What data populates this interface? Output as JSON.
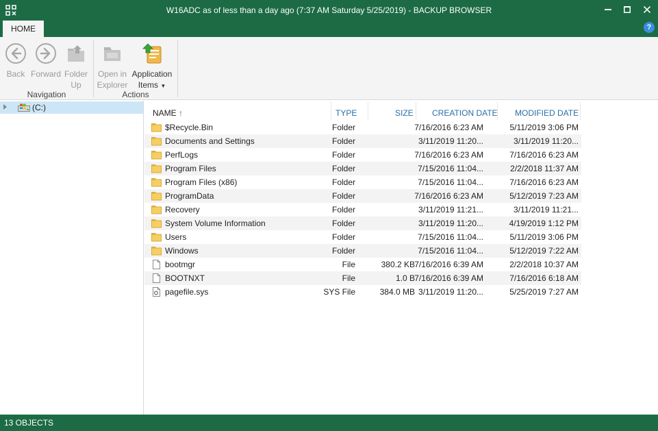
{
  "window": {
    "title": "W16ADC as of less than a day ago (7:37 AM Saturday 5/25/2019) - BACKUP BROWSER",
    "accent_color": "#1c6b45"
  },
  "tabs": {
    "home": "HOME",
    "help": "?"
  },
  "ribbon": {
    "navigation": {
      "label": "Navigation",
      "back": {
        "line1": "Back",
        "icon": "back-arrow-icon"
      },
      "forward": {
        "line1": "Forward",
        "icon": "forward-arrow-icon"
      },
      "folder_up": {
        "line1": "Folder",
        "line2": "Up",
        "icon": "folder-up-icon"
      }
    },
    "actions": {
      "label": "Actions",
      "open_in_explorer": {
        "line1": "Open in",
        "line2": "Explorer",
        "icon": "explorer-folder-icon"
      },
      "application_items": {
        "line1": "Application",
        "line2": "Items",
        "icon": "application-items-icon"
      }
    }
  },
  "tree": {
    "items": [
      {
        "label": "(C:)",
        "icon": "drive-icon",
        "selected": true
      }
    ]
  },
  "list": {
    "columns": {
      "name": "NAME",
      "type": "TYPE",
      "size": "SIZE",
      "created": "CREATION DATE",
      "modified": "MODIFIED DATE"
    },
    "sort_column": "name",
    "rows": [
      {
        "name": "$Recycle.Bin",
        "type": "Folder",
        "size": "",
        "created": "7/16/2016 6:23 AM",
        "modified": "5/11/2019 3:06 PM",
        "icon": "folder"
      },
      {
        "name": "Documents and Settings",
        "type": "Folder",
        "size": "",
        "created": "3/11/2019 11:20...",
        "modified": "3/11/2019 11:20...",
        "icon": "folder"
      },
      {
        "name": "PerfLogs",
        "type": "Folder",
        "size": "",
        "created": "7/16/2016 6:23 AM",
        "modified": "7/16/2016 6:23 AM",
        "icon": "folder"
      },
      {
        "name": "Program Files",
        "type": "Folder",
        "size": "",
        "created": "7/15/2016 11:04...",
        "modified": "2/2/2018 11:37 AM",
        "icon": "folder"
      },
      {
        "name": "Program Files (x86)",
        "type": "Folder",
        "size": "",
        "created": "7/15/2016 11:04...",
        "modified": "7/16/2016 6:23 AM",
        "icon": "folder"
      },
      {
        "name": "ProgramData",
        "type": "Folder",
        "size": "",
        "created": "7/16/2016 6:23 AM",
        "modified": "5/12/2019 7:23 AM",
        "icon": "folder"
      },
      {
        "name": "Recovery",
        "type": "Folder",
        "size": "",
        "created": "3/11/2019 11:21...",
        "modified": "3/11/2019 11:21...",
        "icon": "folder"
      },
      {
        "name": "System Volume Information",
        "type": "Folder",
        "size": "",
        "created": "3/11/2019 11:20...",
        "modified": "4/19/2019 1:12 PM",
        "icon": "folder"
      },
      {
        "name": "Users",
        "type": "Folder",
        "size": "",
        "created": "7/15/2016 11:04...",
        "modified": "5/11/2019 3:06 PM",
        "icon": "folder"
      },
      {
        "name": "Windows",
        "type": "Folder",
        "size": "",
        "created": "7/15/2016 11:04...",
        "modified": "5/12/2019 7:22 AM",
        "icon": "folder"
      },
      {
        "name": "bootmgr",
        "type": "File",
        "size": "380.2 KB",
        "created": "7/16/2016 6:39 AM",
        "modified": "2/2/2018 10:37 AM",
        "icon": "file"
      },
      {
        "name": "BOOTNXT",
        "type": "File",
        "size": "1.0 B",
        "created": "7/16/2016 6:39 AM",
        "modified": "7/16/2016 6:18 AM",
        "icon": "file"
      },
      {
        "name": "pagefile.sys",
        "type": "SYS File",
        "size": "384.0 MB",
        "created": "3/11/2019 11:20...",
        "modified": "5/25/2019 7:27 AM",
        "icon": "sys-file"
      }
    ]
  },
  "status": {
    "objects": "13 OBJECTS"
  }
}
